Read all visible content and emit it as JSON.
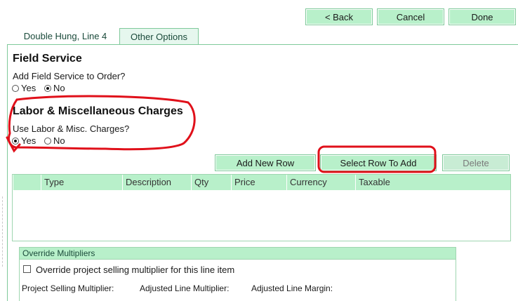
{
  "nav": {
    "back_label": "< Back",
    "cancel_label": "Cancel",
    "done_label": "Done"
  },
  "tabs": [
    {
      "label": "Double Hung, Line 4",
      "active": false
    },
    {
      "label": "Other Options",
      "active": true
    }
  ],
  "field_service": {
    "title": "Field Service",
    "question": "Add Field Service to Order?",
    "yes_label": "Yes",
    "no_label": "No",
    "selected": "No"
  },
  "labor": {
    "title": "Labor & Miscellaneous Charges",
    "question": "Use Labor & Misc. Charges?",
    "yes_label": "Yes",
    "no_label": "No",
    "selected": "Yes"
  },
  "grid_actions": {
    "add_label": "Add New Row",
    "select_label": "Select Row To Add",
    "delete_label": "Delete"
  },
  "grid": {
    "columns": [
      "Type",
      "Description",
      "Qty",
      "Price",
      "Currency",
      "Taxable"
    ],
    "rows": []
  },
  "override": {
    "title": "Override Multipliers",
    "checkbox_label": "Override project selling multiplier for this line item",
    "checked": false,
    "project_multiplier_label": "Project Selling Multiplier:",
    "adjusted_multiplier_label": "Adjusted Line Multiplier:",
    "adjusted_margin_label": "Adjusted Line Margin:"
  },
  "colors": {
    "button_bg": "#b8f0ca",
    "border_green": "#7fc99a",
    "annotation_red": "#e0101a"
  }
}
